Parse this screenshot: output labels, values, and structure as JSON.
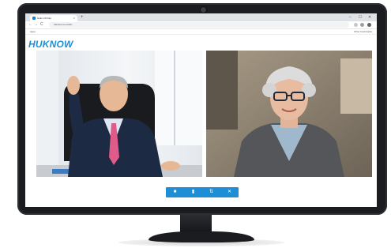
{
  "browser": {
    "tab_title": "Hello Lift Kap",
    "tab_close": "×",
    "new_tab": "+",
    "window_controls": [
      "–",
      "☐",
      "✕"
    ],
    "nav": [
      "←",
      "→",
      "C"
    ],
    "url": "haknow.com/call/...",
    "bookmarks_apps": "Apps",
    "bookmarks_other": "Other bookmarks"
  },
  "brand": {
    "logo_text": "HUKNOW",
    "accent": "#1e8fd6"
  },
  "call": {
    "participants": [
      "man-in-suit",
      "elderly-woman-with-glasses"
    ],
    "controls": [
      {
        "name": "video-camera-icon",
        "glyph": "■"
      },
      {
        "name": "microphone-icon",
        "glyph": "▮"
      },
      {
        "name": "switch-camera-icon",
        "glyph": "⇅"
      },
      {
        "name": "end-call-icon",
        "glyph": "✕"
      }
    ]
  }
}
